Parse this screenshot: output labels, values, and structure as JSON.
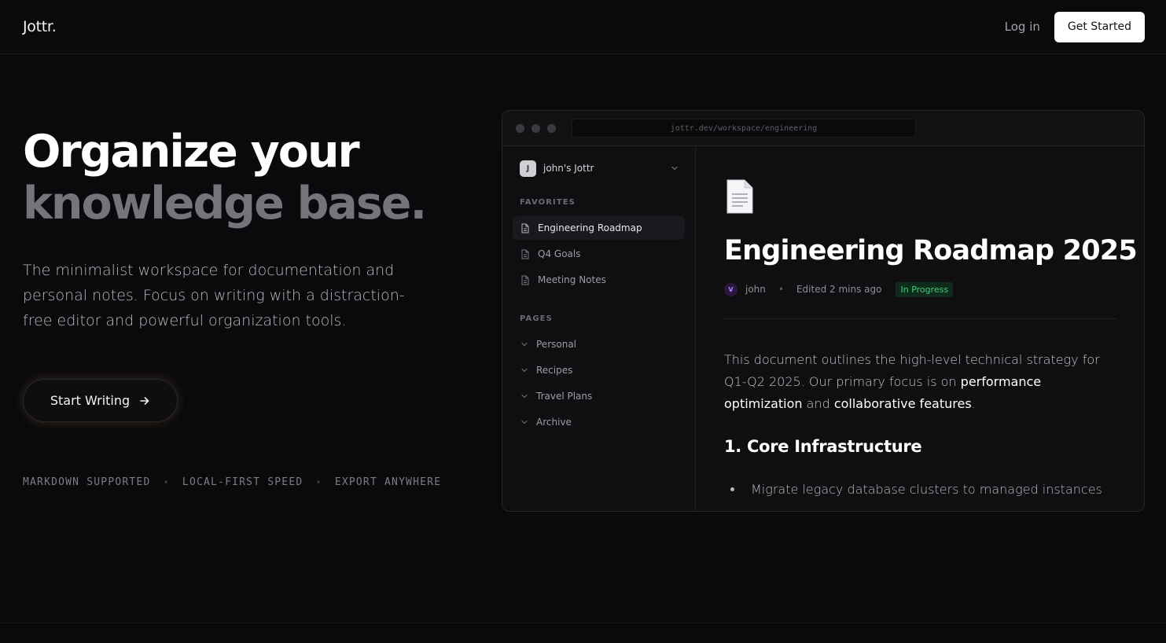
{
  "header": {
    "logo": "Jottr.",
    "login": "Log in",
    "get_started": "Get Started"
  },
  "hero": {
    "title_line1": "Organize your",
    "title_line2": "knowledge base.",
    "subtitle": "The minimalist workspace for documentation and personal notes. Focus on writing with a distraction-free editor and powerful organization tools.",
    "cta": "Start Writing",
    "features": [
      "MARKDOWN SUPPORTED",
      "LOCAL-FIRST SPEED",
      "EXPORT ANYWHERE"
    ]
  },
  "app": {
    "url": "jottr.dev/workspace/engineering",
    "workspace": {
      "avatar": "J",
      "name": "john's Jottr"
    },
    "favorites_label": "FAVORITES",
    "favorites": [
      {
        "label": "Engineering Roadmap",
        "active": true
      },
      {
        "label": "Q4 Goals",
        "active": false
      },
      {
        "label": "Meeting Notes",
        "active": false
      }
    ],
    "pages_label": "PAGES",
    "pages": [
      {
        "label": "Personal"
      },
      {
        "label": "Recipes"
      },
      {
        "label": "Travel Plans"
      },
      {
        "label": "Archive"
      }
    ],
    "doc": {
      "icon": "page-document-icon",
      "title": "Engineering Roadmap 2025",
      "author_avatar": "V",
      "author": "john",
      "separator": "•",
      "edited": "Edited 2 mins ago",
      "status": "In Progress",
      "para_start": "This document outlines the high-level technical strategy for Q1-Q2 2025. Our primary focus is on ",
      "para_bold1": "performance optimization",
      "para_mid": " and ",
      "para_bold2": "collaborative features",
      "para_end": ".",
      "heading": "1. Core Infrastructure",
      "list": [
        "Migrate legacy database clusters to managed instances"
      ]
    }
  },
  "colors": {
    "background": "#0a0a0c",
    "accent_green": "#3fd17d",
    "accent_purple": "#b583ff"
  }
}
